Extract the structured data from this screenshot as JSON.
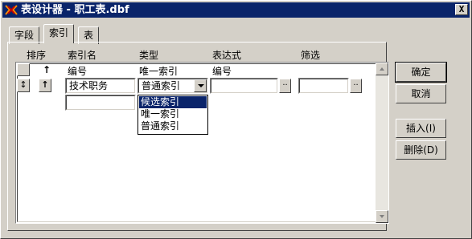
{
  "window": {
    "title": "表设计器 - 职工表.dbf",
    "close_label": "X"
  },
  "tabs": [
    {
      "label": "字段"
    },
    {
      "label": "索引"
    },
    {
      "label": "表"
    }
  ],
  "columns": {
    "sort": "排序",
    "index_name": "索引名",
    "type": "类型",
    "expression": "表达式",
    "filter": "筛选"
  },
  "rows": [
    {
      "sort_arrow": "↑",
      "index_name": "编号",
      "type": "唯一索引",
      "expression": "编号",
      "filter": ""
    },
    {
      "sort_arrow": "↑",
      "index_name": "技术职务",
      "type": "普通索引",
      "expression": "",
      "filter": ""
    },
    {
      "index_name": ""
    }
  ],
  "mover_label": "↕",
  "dots_label": "..",
  "dropdown": {
    "options": [
      "候选索引",
      "唯一索引",
      "普通索引"
    ],
    "selected_index": 0
  },
  "buttons": {
    "ok": "确定",
    "cancel": "取消",
    "insert": "插入(I)",
    "delete": "删除(D)"
  }
}
